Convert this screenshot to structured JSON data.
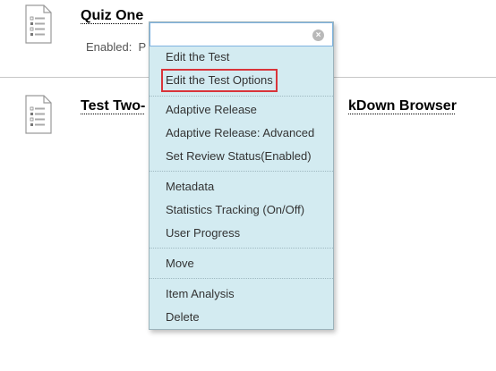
{
  "items": [
    {
      "title": "Quiz One",
      "detail": "Enabled:  P"
    },
    {
      "title": "Test Two-",
      "title_tail": "kDown Browser"
    }
  ],
  "menu": {
    "groups": [
      [
        "Edit the Test",
        "Edit the Test Options"
      ],
      [
        "Adaptive Release",
        "Adaptive Release: Advanced",
        "Set Review Status(Enabled)"
      ],
      [
        "Metadata",
        "Statistics Tracking (On/Off)",
        "User Progress"
      ],
      [
        "Move"
      ],
      [
        "Item Analysis",
        "Delete"
      ]
    ],
    "highlighted": "Edit the Test Options",
    "close_icon": "×"
  },
  "colors": {
    "menu_bg": "#d3ebf1",
    "highlight_border": "#d9343a",
    "header_border": "#7fb3e0"
  }
}
